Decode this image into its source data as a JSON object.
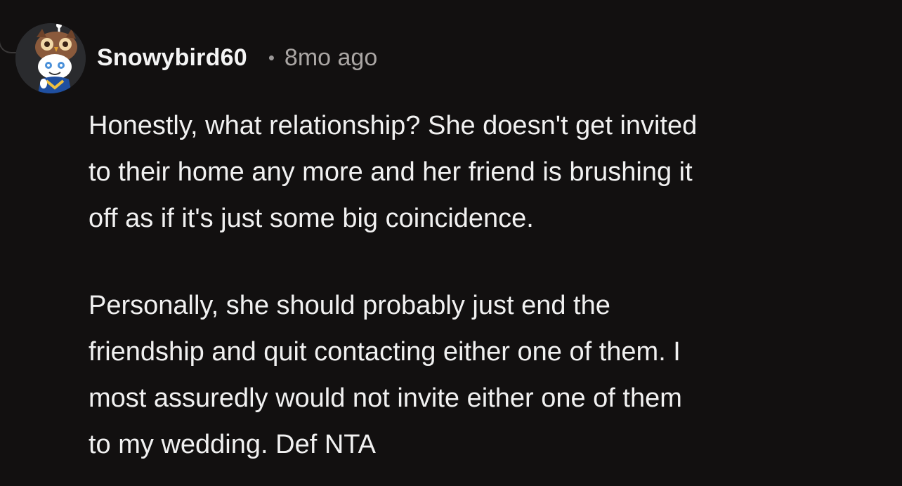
{
  "comment": {
    "username": "Snowybird60",
    "separator": "•",
    "timestamp": "8mo ago",
    "avatar_icon": "owl-snoo-avatar-icon",
    "paragraphs": [
      "Honestly, what relationship? She doesn't get invited\nto their home any more and her friend is brushing it\noff as if it's just some big coincidence.",
      "Personally, she should probably just end the\nfriendship and quit contacting either one of them. I\nmost assuredly would not invite either one of them\nto my wedding. Def NTA"
    ]
  },
  "colors": {
    "background": "#121010",
    "text": "#f1f1f1",
    "muted": "#aaa6a4"
  }
}
